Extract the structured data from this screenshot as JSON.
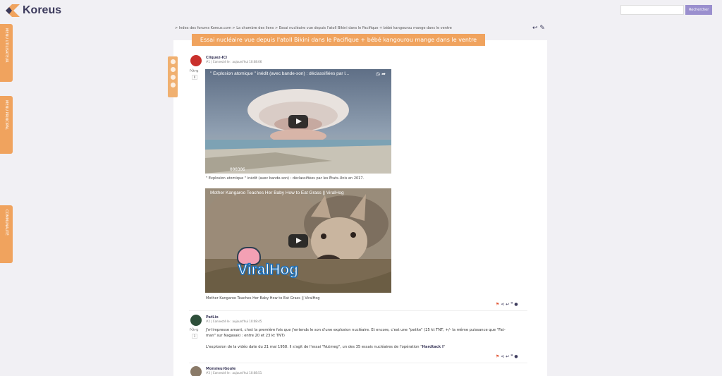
{
  "header": {
    "logo_text": "Koreus",
    "search_placeholder": "",
    "search_button": "Rechercher"
  },
  "side_tabs": [
    "MENU UTILISATEUR",
    "MENU PRINCIPAL",
    "COMMUNAUTÉ"
  ],
  "breadcrumb": "> Index des forums Koreus.com  > La chambre des liens  > Essai nucléaire vue depuis l'atoll Bikini dans le Pacifique + bébé kangourou mange dans le ventre",
  "thread_title": "Essai nucléaire vue depuis l'atoll Bikini dans le Pacifique + bébé kangourou mange dans le ventre",
  "posts": [
    {
      "user": "Cliquez-ICI",
      "meta": "#1 | Connecté le : aujourd'hui 10:08:06",
      "vote_count": "0",
      "video1": {
        "title": "\" Explosion atomique \" inédit (avec bande-son) : déclassifiées par l...",
        "timecode": "000306",
        "caption": "\" Explosion atomique \" inédit (avec bande-son) : déclassifiées par les États-Unis en 2017."
      },
      "video2": {
        "title": "Mother Kangaroo Teaches Her Baby How to Eat Grass || ViralHog",
        "watermark": "ViralHog",
        "caption": "Mother Kangaroo Teaches Her Baby How to Eat Grass || ViralHog"
      }
    },
    {
      "user": "PatLio",
      "meta": "#2 | Connecté le : aujourd'hui 10:08:45",
      "vote_count": "1",
      "text1": "J'm'impresse amant, c'est la première fois que j'entends le son d'une explosion nucléaire. Et encore, c'est une \"petite\" (25 kt TNT, +/- la même puissance que \"Fat-",
      "text2": "man\" sur Nagasaki : entre 20 et 23 kt TNT)",
      "text3a": "L'explosion de la vidéo date du 21 mai 1958. Il s'agit de l'essai \"Nutmeg\", un des 35 essais nucléaires de l'opération \"",
      "text3b": "Hardtack I",
      "text3c": "\""
    },
    {
      "user": "MonsieurGoule",
      "meta": "#3 | Connecté le : aujourd'hui 10:08:51"
    }
  ]
}
